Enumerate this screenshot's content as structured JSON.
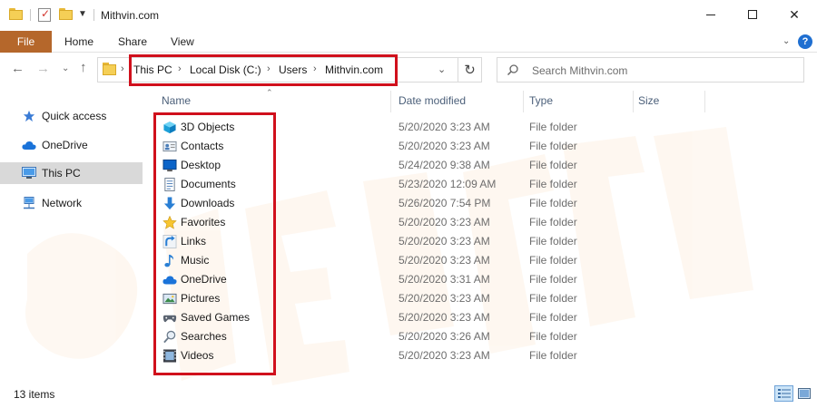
{
  "window": {
    "title": "Mithvin.com",
    "controls": {
      "minimize": "minimize",
      "maximize": "maximize",
      "close": "✕"
    }
  },
  "ribbon": {
    "tabs": [
      "File",
      "Home",
      "Share",
      "View"
    ],
    "help": "?"
  },
  "nav": {
    "breadcrumb": [
      "This PC",
      "Local Disk (C:)",
      "Users",
      "Mithvin.com"
    ],
    "search_placeholder": "Search Mithvin.com"
  },
  "sidebar": {
    "items": [
      {
        "label": "Quick access",
        "icon": "star-icon"
      },
      {
        "label": "OneDrive",
        "icon": "cloud-icon"
      },
      {
        "label": "This PC",
        "icon": "computer-icon",
        "selected": true
      },
      {
        "label": "Network",
        "icon": "network-icon"
      }
    ]
  },
  "columns": [
    "Name",
    "Date modified",
    "Type",
    "Size"
  ],
  "rows": [
    {
      "name": "3D Objects",
      "date": "5/20/2020 3:23 AM",
      "type": "File folder",
      "icon": "3d-objects-icon"
    },
    {
      "name": "Contacts",
      "date": "5/20/2020 3:23 AM",
      "type": "File folder",
      "icon": "contacts-icon"
    },
    {
      "name": "Desktop",
      "date": "5/24/2020 9:38 AM",
      "type": "File folder",
      "icon": "desktop-icon"
    },
    {
      "name": "Documents",
      "date": "5/23/2020 12:09 AM",
      "type": "File folder",
      "icon": "documents-icon"
    },
    {
      "name": "Downloads",
      "date": "5/26/2020 7:54 PM",
      "type": "File folder",
      "icon": "downloads-icon"
    },
    {
      "name": "Favorites",
      "date": "5/20/2020 3:23 AM",
      "type": "File folder",
      "icon": "favorites-icon"
    },
    {
      "name": "Links",
      "date": "5/20/2020 3:23 AM",
      "type": "File folder",
      "icon": "links-icon"
    },
    {
      "name": "Music",
      "date": "5/20/2020 3:23 AM",
      "type": "File folder",
      "icon": "music-icon"
    },
    {
      "name": "OneDrive",
      "date": "5/20/2020 3:31 AM",
      "type": "File folder",
      "icon": "onedrive-icon"
    },
    {
      "name": "Pictures",
      "date": "5/20/2020 3:23 AM",
      "type": "File folder",
      "icon": "pictures-icon"
    },
    {
      "name": "Saved Games",
      "date": "5/20/2020 3:23 AM",
      "type": "File folder",
      "icon": "saved-games-icon"
    },
    {
      "name": "Searches",
      "date": "5/20/2020 3:26 AM",
      "type": "File folder",
      "icon": "searches-icon"
    },
    {
      "name": "Videos",
      "date": "5/20/2020 3:23 AM",
      "type": "File folder",
      "icon": "videos-icon"
    }
  ],
  "status": {
    "item_count": "13 items"
  },
  "colors": {
    "file_tab": "#b5672b",
    "highlight": "#d0101c",
    "header_text": "#4c607a",
    "selected_bg": "#d9d9d9"
  }
}
